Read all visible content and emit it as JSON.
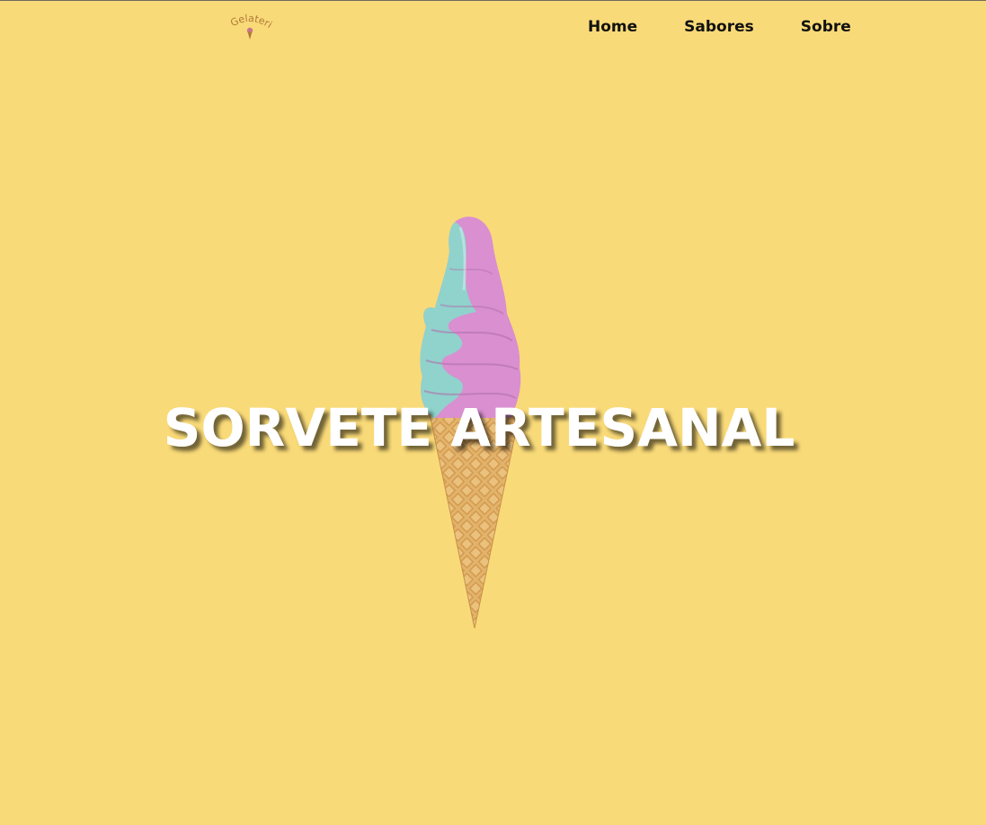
{
  "logo": {
    "text": "Gelateria",
    "icon": "ice-cream-cone-icon",
    "color": "#b07a3a"
  },
  "nav": {
    "items": [
      {
        "label": "Home"
      },
      {
        "label": "Sabores"
      },
      {
        "label": "Sobre"
      }
    ]
  },
  "hero": {
    "title": "SORVETE ARTESANAL",
    "image": "soft-serve-ice-cream-cone",
    "colors": {
      "background": "#f9da78",
      "title": "#ffffff",
      "teal": "#8fd3cc",
      "pink": "#d98fd0",
      "cone": "#e0b06a"
    }
  }
}
